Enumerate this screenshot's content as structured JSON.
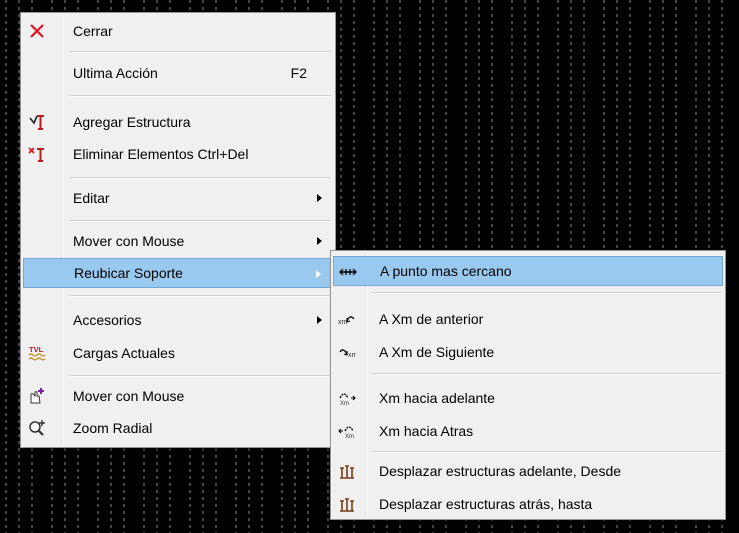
{
  "main_menu": {
    "items": [
      {
        "label": "Cerrar",
        "icon": "close-icon"
      },
      {
        "label": "Ultima Acción",
        "shortcut": "F2"
      },
      {
        "label": "Agregar Estructura",
        "icon": "add-structure-icon"
      },
      {
        "label": "Eliminar Elementos",
        "shortcut": "Ctrl+Del",
        "icon": "delete-elements-icon"
      },
      {
        "label": "Editar",
        "submenu": true
      },
      {
        "label": "Mover con Mouse",
        "submenu": true
      },
      {
        "label": "Reubicar Soporte",
        "submenu": true,
        "highlighted": true
      },
      {
        "label": "Accesorios",
        "submenu": true
      },
      {
        "label": "Cargas Actuales",
        "icon": "loads-icon"
      },
      {
        "label": "Mover con Mouse",
        "icon": "move-mouse-icon"
      },
      {
        "label": "Zoom Radial",
        "icon": "zoom-radial-icon"
      }
    ]
  },
  "sub_menu": {
    "items": [
      {
        "label": "A punto mas cercano",
        "icon": "nearest-point-icon",
        "highlighted": true
      },
      {
        "label": "A Xm de anterior",
        "icon": "xm-previous-icon"
      },
      {
        "label": "A Xm de Siguiente",
        "icon": "xm-next-icon"
      },
      {
        "label": "Xm hacia adelante",
        "icon": "xm-forward-icon"
      },
      {
        "label": "Xm hacia Atras",
        "icon": "xm-backward-icon"
      },
      {
        "label": "Desplazar estructuras adelante, Desde",
        "icon": "shift-forward-icon"
      },
      {
        "label": "Desplazar estructuras atrás, hasta",
        "icon": "shift-backward-icon"
      }
    ]
  },
  "colors": {
    "highlight": "#99c9ef",
    "close_red": "#e81123",
    "menu_bg": "#f0f0f0"
  }
}
